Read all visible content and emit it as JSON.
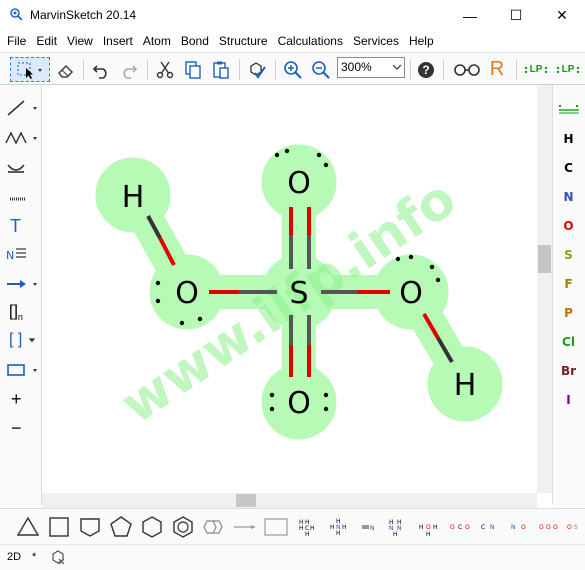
{
  "window": {
    "title": "MarvinSketch 20.14",
    "minimize_glyph": "—",
    "maximize_glyph": "☐",
    "close_glyph": "✕"
  },
  "menu": [
    {
      "label": "File"
    },
    {
      "label": "Edit"
    },
    {
      "label": "View"
    },
    {
      "label": "Insert"
    },
    {
      "label": "Atom"
    },
    {
      "label": "Bond"
    },
    {
      "label": "Structure"
    },
    {
      "label": "Calculations"
    },
    {
      "label": "Services"
    },
    {
      "label": "Help"
    }
  ],
  "toolbar": {
    "zoom_value": "300%",
    "help_glyph": "?",
    "r_label": "R",
    "lp_label": "LP"
  },
  "left_tools": {
    "text_glyph": "T",
    "bracket_label": "[]",
    "bracket_sub": "n",
    "bracket2_label": "[ ]",
    "plus_glyph": "+",
    "minus_glyph": "−"
  },
  "elements": [
    {
      "symbol": "H",
      "color": "#000000"
    },
    {
      "symbol": "C",
      "color": "#000000"
    },
    {
      "symbol": "N",
      "color": "#3050c0"
    },
    {
      "symbol": "O",
      "color": "#e00000"
    },
    {
      "symbol": "S",
      "color": "#9a9a00"
    },
    {
      "symbol": "F",
      "color": "#a08000"
    },
    {
      "symbol": "P",
      "color": "#c07000"
    },
    {
      "symbol": "Cl",
      "color": "#10a010"
    },
    {
      "symbol": "Br",
      "color": "#7a2020"
    },
    {
      "symbol": "I",
      "color": "#800080"
    }
  ],
  "molecule": {
    "atoms": [
      {
        "id": "H1",
        "label": "H"
      },
      {
        "id": "O1",
        "label": "O"
      },
      {
        "id": "S",
        "label": "S"
      },
      {
        "id": "O_top",
        "label": "O"
      },
      {
        "id": "O_bottom",
        "label": "O"
      },
      {
        "id": "O2",
        "label": "O"
      },
      {
        "id": "H2",
        "label": "H"
      }
    ],
    "highlight_color": "#b6fab6"
  },
  "watermark": "www.ilfp.info",
  "status": {
    "mode": "2D",
    "modified": "*"
  }
}
